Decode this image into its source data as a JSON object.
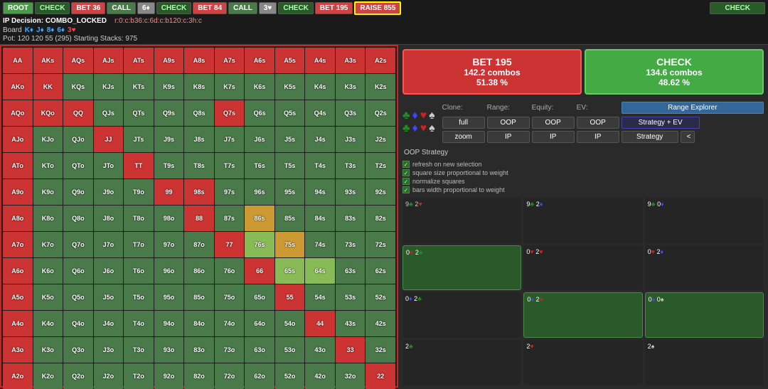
{
  "topbar": {
    "buttons": [
      {
        "label": "ROOT",
        "cls": "nav-root"
      },
      {
        "label": "CHECK",
        "cls": "nav-check"
      },
      {
        "label": "BET 36",
        "cls": "nav-bet36"
      },
      {
        "label": "CALL",
        "cls": "nav-call"
      },
      {
        "label": "6♦",
        "cls": "nav-6plus"
      },
      {
        "label": "CHECK",
        "cls": "nav-check"
      },
      {
        "label": "BET 84",
        "cls": "nav-bet84"
      },
      {
        "label": "CALL",
        "cls": "nav-call"
      },
      {
        "label": "3♥",
        "cls": "nav-3v"
      },
      {
        "label": "CHECK",
        "cls": "nav-check"
      },
      {
        "label": "BET 195",
        "cls": "nav-bet195"
      },
      {
        "label": "RAISE 855",
        "cls": "nav-raise855"
      },
      {
        "label": "CHECK",
        "cls": "nav-check2"
      }
    ]
  },
  "infobar": {
    "ip_decision": "IP Decision: COMBO_LOCKED",
    "range": "r:0:c:b36:c:6d:c:b120:c:3h:c",
    "board_label": "Board",
    "cards": [
      "K♦",
      "J♦",
      "8♦",
      "6♦",
      "3♥"
    ],
    "pot": "Pot: 120 120 55 (295) Starting Stacks: 975"
  },
  "actions": {
    "bet": {
      "title": "BET 195",
      "combos": "142.2 combos",
      "pct": "51.38 %"
    },
    "check": {
      "title": "CHECK",
      "combos": "134.6 combos",
      "pct": "48.62 %"
    }
  },
  "controls": {
    "clone_label": "Clone:",
    "range_label": "Range:",
    "equity_label": "Equity:",
    "ev_label": "EV:",
    "range_explorer": "Range Explorer",
    "full": "full",
    "zoom": "zoom",
    "oop1": "OOP",
    "oop2": "OOP",
    "oop3": "OOP",
    "ip1": "IP",
    "ip2": "IP",
    "ip3": "IP",
    "strategy_ev": "Strategy + EV",
    "strategy": "Strategy",
    "expand": "<",
    "oop_strategy": "OOP Strategy"
  },
  "checkboxes": [
    "refresh on new selection",
    "square size proportional to weight",
    "normalize squares",
    "bars width proportional to weight"
  ],
  "card_grid": [
    {
      "label": "9♣ 2♥",
      "cls": "card-cell-dark"
    },
    {
      "label": "9♣ 2♦",
      "cls": "card-cell-dark"
    },
    {
      "label": "9♣ 0♦",
      "cls": "card-cell-dark"
    },
    {
      "label": "0♥ 2♣",
      "cls": "card-cell-green"
    },
    {
      "label": "0♥ 2♥",
      "cls": "card-cell-dark"
    },
    {
      "label": "0♥ 2♦",
      "cls": "card-cell-dark"
    },
    {
      "label": "0♦ 2♣",
      "cls": "card-cell-dark"
    },
    {
      "label": "0♦ 2♥",
      "cls": "card-cell-green"
    },
    {
      "label": "0♦ 0♠",
      "cls": "card-cell-green"
    },
    {
      "label": "2♣",
      "cls": "card-cell-dark"
    },
    {
      "label": "2♥",
      "cls": "card-cell-dark"
    },
    {
      "label": "2♠",
      "cls": "card-cell-dark"
    }
  ],
  "matrix": {
    "headers": [
      "AA",
      "AKs",
      "AQs",
      "AJs",
      "ATs",
      "A9s",
      "A8s",
      "A7s",
      "A6s",
      "A5s",
      "A4s",
      "A3s",
      "A2s"
    ],
    "rows": [
      {
        "cells": [
          {
            "label": "AA",
            "bg": "#cc3333"
          },
          {
            "label": "AKs",
            "bg": "#cc3333"
          },
          {
            "label": "AQs",
            "bg": "#cc3333"
          },
          {
            "label": "AJs",
            "bg": "#cc3333"
          },
          {
            "label": "ATs",
            "bg": "#cc3333"
          },
          {
            "label": "A9s",
            "bg": "#cc3333"
          },
          {
            "label": "A8s",
            "bg": "#cc3333"
          },
          {
            "label": "A7s",
            "bg": "#cc3333"
          },
          {
            "label": "A6s",
            "bg": "#cc3333"
          },
          {
            "label": "A5s",
            "bg": "#cc3333"
          },
          {
            "label": "A4s",
            "bg": "#cc3333"
          },
          {
            "label": "A3s",
            "bg": "#cc3333"
          },
          {
            "label": "A2s",
            "bg": "#cc3333"
          }
        ]
      },
      {
        "cells": [
          {
            "label": "AKo",
            "bg": "#cc3333"
          },
          {
            "label": "KK",
            "bg": "#cc3333"
          },
          {
            "label": "KQs",
            "bg": "#4a7a4a"
          },
          {
            "label": "KJs",
            "bg": "#4a7a4a"
          },
          {
            "label": "KTs",
            "bg": "#4a7a4a"
          },
          {
            "label": "K9s",
            "bg": "#4a7a4a"
          },
          {
            "label": "K8s",
            "bg": "#4a7a4a"
          },
          {
            "label": "K7s",
            "bg": "#4a7a4a"
          },
          {
            "label": "K6s",
            "bg": "#4a7a4a"
          },
          {
            "label": "K5s",
            "bg": "#4a7a4a"
          },
          {
            "label": "K4s",
            "bg": "#4a7a4a"
          },
          {
            "label": "K3s",
            "bg": "#4a7a4a"
          },
          {
            "label": "K2s",
            "bg": "#4a7a4a"
          }
        ]
      },
      {
        "cells": [
          {
            "label": "AQo",
            "bg": "#cc3333"
          },
          {
            "label": "KQo",
            "bg": "#cc3333"
          },
          {
            "label": "QQ",
            "bg": "#cc3333"
          },
          {
            "label": "QJs",
            "bg": "#4a7a4a"
          },
          {
            "label": "QTs",
            "bg": "#4a7a4a"
          },
          {
            "label": "Q9s",
            "bg": "#4a7a4a"
          },
          {
            "label": "Q8s",
            "bg": "#4a7a4a"
          },
          {
            "label": "Q7s",
            "bg": "#cc3333"
          },
          {
            "label": "Q6s",
            "bg": "#4a7a4a"
          },
          {
            "label": "Q5s",
            "bg": "#4a7a4a"
          },
          {
            "label": "Q4s",
            "bg": "#4a7a4a"
          },
          {
            "label": "Q3s",
            "bg": "#4a7a4a"
          },
          {
            "label": "Q2s",
            "bg": "#4a7a4a"
          }
        ]
      },
      {
        "cells": [
          {
            "label": "AJo",
            "bg": "#cc3333"
          },
          {
            "label": "KJo",
            "bg": "#4a7a4a"
          },
          {
            "label": "QJo",
            "bg": "#4a7a4a"
          },
          {
            "label": "JJ",
            "bg": "#cc3333"
          },
          {
            "label": "JTs",
            "bg": "#4a7a4a"
          },
          {
            "label": "J9s",
            "bg": "#4a7a4a"
          },
          {
            "label": "J8s",
            "bg": "#4a7a4a"
          },
          {
            "label": "J7s",
            "bg": "#4a7a4a"
          },
          {
            "label": "J6s",
            "bg": "#4a7a4a"
          },
          {
            "label": "J5s",
            "bg": "#4a7a4a"
          },
          {
            "label": "J4s",
            "bg": "#4a7a4a"
          },
          {
            "label": "J3s",
            "bg": "#4a7a4a"
          },
          {
            "label": "J2s",
            "bg": "#4a7a4a"
          }
        ]
      },
      {
        "cells": [
          {
            "label": "ATo",
            "bg": "#cc3333"
          },
          {
            "label": "KTo",
            "bg": "#4a7a4a"
          },
          {
            "label": "QTo",
            "bg": "#4a7a4a"
          },
          {
            "label": "JTo",
            "bg": "#4a7a4a"
          },
          {
            "label": "TT",
            "bg": "#cc3333"
          },
          {
            "label": "T9s",
            "bg": "#4a7a4a"
          },
          {
            "label": "T8s",
            "bg": "#4a7a4a"
          },
          {
            "label": "T7s",
            "bg": "#4a7a4a"
          },
          {
            "label": "T6s",
            "bg": "#4a7a4a"
          },
          {
            "label": "T5s",
            "bg": "#4a7a4a"
          },
          {
            "label": "T4s",
            "bg": "#4a7a4a"
          },
          {
            "label": "T3s",
            "bg": "#4a7a4a"
          },
          {
            "label": "T2s",
            "bg": "#4a7a4a"
          }
        ]
      },
      {
        "cells": [
          {
            "label": "A9o",
            "bg": "#cc3333"
          },
          {
            "label": "K9o",
            "bg": "#4a7a4a"
          },
          {
            "label": "Q9o",
            "bg": "#4a7a4a"
          },
          {
            "label": "J9o",
            "bg": "#4a7a4a"
          },
          {
            "label": "T9o",
            "bg": "#4a7a4a"
          },
          {
            "label": "99",
            "bg": "#cc3333"
          },
          {
            "label": "98s",
            "bg": "#cc3333"
          },
          {
            "label": "97s",
            "bg": "#4a7a4a"
          },
          {
            "label": "96s",
            "bg": "#4a7a4a"
          },
          {
            "label": "95s",
            "bg": "#4a7a4a"
          },
          {
            "label": "94s",
            "bg": "#4a7a4a"
          },
          {
            "label": "93s",
            "bg": "#4a7a4a"
          },
          {
            "label": "92s",
            "bg": "#4a7a4a"
          }
        ]
      },
      {
        "cells": [
          {
            "label": "A8o",
            "bg": "#cc3333"
          },
          {
            "label": "K8o",
            "bg": "#4a7a4a"
          },
          {
            "label": "Q8o",
            "bg": "#4a7a4a"
          },
          {
            "label": "J8o",
            "bg": "#4a7a4a"
          },
          {
            "label": "T8o",
            "bg": "#4a7a4a"
          },
          {
            "label": "98o",
            "bg": "#4a7a4a"
          },
          {
            "label": "88",
            "bg": "#cc3333"
          },
          {
            "label": "87s",
            "bg": "#4a7a4a"
          },
          {
            "label": "86s",
            "bg": "#cc9933"
          },
          {
            "label": "85s",
            "bg": "#4a7a4a"
          },
          {
            "label": "84s",
            "bg": "#4a7a4a"
          },
          {
            "label": "83s",
            "bg": "#4a7a4a"
          },
          {
            "label": "82s",
            "bg": "#4a7a4a"
          }
        ]
      },
      {
        "cells": [
          {
            "label": "A7o",
            "bg": "#cc3333"
          },
          {
            "label": "K7o",
            "bg": "#4a7a4a"
          },
          {
            "label": "Q7o",
            "bg": "#4a7a4a"
          },
          {
            "label": "J7o",
            "bg": "#4a7a4a"
          },
          {
            "label": "T7o",
            "bg": "#4a7a4a"
          },
          {
            "label": "97o",
            "bg": "#4a7a4a"
          },
          {
            "label": "87o",
            "bg": "#4a7a4a"
          },
          {
            "label": "77",
            "bg": "#cc3333"
          },
          {
            "label": "76s",
            "bg": "#88bb55"
          },
          {
            "label": "75s",
            "bg": "#cc9933"
          },
          {
            "label": "74s",
            "bg": "#4a7a4a"
          },
          {
            "label": "73s",
            "bg": "#4a7a4a"
          },
          {
            "label": "72s",
            "bg": "#4a7a4a"
          }
        ]
      },
      {
        "cells": [
          {
            "label": "A6o",
            "bg": "#cc3333"
          },
          {
            "label": "K6o",
            "bg": "#4a7a4a"
          },
          {
            "label": "Q6o",
            "bg": "#4a7a4a"
          },
          {
            "label": "J6o",
            "bg": "#4a7a4a"
          },
          {
            "label": "T6o",
            "bg": "#4a7a4a"
          },
          {
            "label": "96o",
            "bg": "#4a7a4a"
          },
          {
            "label": "86o",
            "bg": "#4a7a4a"
          },
          {
            "label": "76o",
            "bg": "#4a7a4a"
          },
          {
            "label": "66",
            "bg": "#cc3333"
          },
          {
            "label": "65s",
            "bg": "#88bb55"
          },
          {
            "label": "64s",
            "bg": "#88bb55"
          },
          {
            "label": "63s",
            "bg": "#4a7a4a"
          },
          {
            "label": "62s",
            "bg": "#4a7a4a"
          }
        ]
      },
      {
        "cells": [
          {
            "label": "A5o",
            "bg": "#cc3333"
          },
          {
            "label": "K5o",
            "bg": "#4a7a4a"
          },
          {
            "label": "Q5o",
            "bg": "#4a7a4a"
          },
          {
            "label": "J5o",
            "bg": "#4a7a4a"
          },
          {
            "label": "T5o",
            "bg": "#4a7a4a"
          },
          {
            "label": "95o",
            "bg": "#4a7a4a"
          },
          {
            "label": "85o",
            "bg": "#4a7a4a"
          },
          {
            "label": "75o",
            "bg": "#4a7a4a"
          },
          {
            "label": "65o",
            "bg": "#4a7a4a"
          },
          {
            "label": "55",
            "bg": "#cc3333"
          },
          {
            "label": "54s",
            "bg": "#4a7a4a"
          },
          {
            "label": "53s",
            "bg": "#4a7a4a"
          },
          {
            "label": "52s",
            "bg": "#4a7a4a"
          }
        ]
      },
      {
        "cells": [
          {
            "label": "A4o",
            "bg": "#cc3333"
          },
          {
            "label": "K4o",
            "bg": "#4a7a4a"
          },
          {
            "label": "Q4o",
            "bg": "#4a7a4a"
          },
          {
            "label": "J4o",
            "bg": "#4a7a4a"
          },
          {
            "label": "T4o",
            "bg": "#4a7a4a"
          },
          {
            "label": "94o",
            "bg": "#4a7a4a"
          },
          {
            "label": "84o",
            "bg": "#4a7a4a"
          },
          {
            "label": "74o",
            "bg": "#4a7a4a"
          },
          {
            "label": "64o",
            "bg": "#4a7a4a"
          },
          {
            "label": "54o",
            "bg": "#4a7a4a"
          },
          {
            "label": "44",
            "bg": "#cc3333"
          },
          {
            "label": "43s",
            "bg": "#4a7a4a"
          },
          {
            "label": "42s",
            "bg": "#4a7a4a"
          }
        ]
      },
      {
        "cells": [
          {
            "label": "A3o",
            "bg": "#cc3333"
          },
          {
            "label": "K3o",
            "bg": "#4a7a4a"
          },
          {
            "label": "Q3o",
            "bg": "#4a7a4a"
          },
          {
            "label": "J3o",
            "bg": "#4a7a4a"
          },
          {
            "label": "T3o",
            "bg": "#4a7a4a"
          },
          {
            "label": "93o",
            "bg": "#4a7a4a"
          },
          {
            "label": "83o",
            "bg": "#4a7a4a"
          },
          {
            "label": "73o",
            "bg": "#4a7a4a"
          },
          {
            "label": "63o",
            "bg": "#4a7a4a"
          },
          {
            "label": "53o",
            "bg": "#4a7a4a"
          },
          {
            "label": "43o",
            "bg": "#4a7a4a"
          },
          {
            "label": "33",
            "bg": "#cc3333"
          },
          {
            "label": "32s",
            "bg": "#4a7a4a"
          }
        ]
      },
      {
        "cells": [
          {
            "label": "A2o",
            "bg": "#cc3333"
          },
          {
            "label": "K2o",
            "bg": "#4a7a4a"
          },
          {
            "label": "Q2o",
            "bg": "#4a7a4a"
          },
          {
            "label": "J2o",
            "bg": "#4a7a4a"
          },
          {
            "label": "T2o",
            "bg": "#4a7a4a"
          },
          {
            "label": "92o",
            "bg": "#4a7a4a"
          },
          {
            "label": "82o",
            "bg": "#4a7a4a"
          },
          {
            "label": "72o",
            "bg": "#4a7a4a"
          },
          {
            "label": "62o",
            "bg": "#4a7a4a"
          },
          {
            "label": "52o",
            "bg": "#4a7a4a"
          },
          {
            "label": "42o",
            "bg": "#4a7a4a"
          },
          {
            "label": "32o",
            "bg": "#4a7a4a"
          },
          {
            "label": "22",
            "bg": "#cc3333"
          }
        ]
      }
    ]
  }
}
